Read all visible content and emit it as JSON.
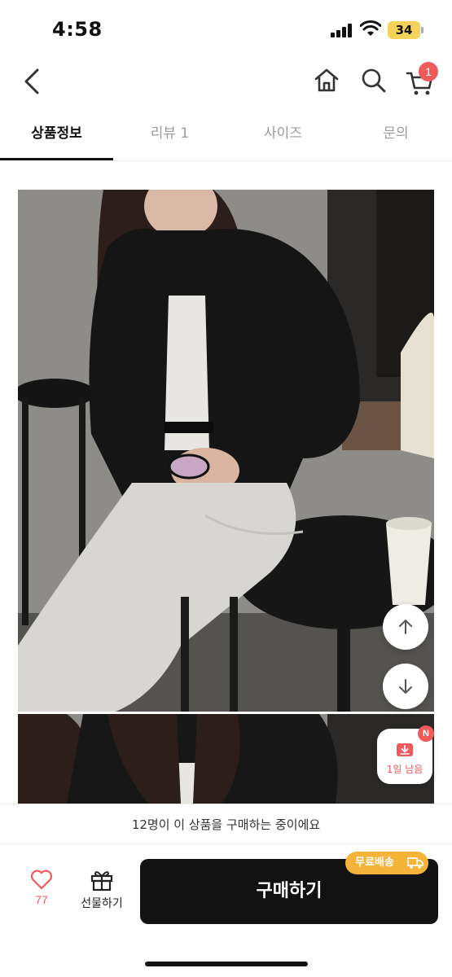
{
  "status_bar": {
    "time": "4:58",
    "battery": "34",
    "icons": [
      "signal-icon",
      "wifi-icon",
      "battery-icon"
    ]
  },
  "header": {
    "icons": [
      "back-icon",
      "home-icon",
      "search-icon",
      "cart-icon"
    ],
    "cart_badge": "1"
  },
  "tabs": [
    {
      "label": "상품정보",
      "active": true
    },
    {
      "label": "리뷰 1",
      "active": false
    },
    {
      "label": "사이즈",
      "active": false
    },
    {
      "label": "문의",
      "active": false
    }
  ],
  "floating": {
    "icons": [
      "arrow-up-icon",
      "arrow-down-icon",
      "ticket-icon"
    ],
    "new_badge": "N",
    "limited_label": "1일 남음"
  },
  "notice": "12명이 이 상품을 구매하는 중이에요",
  "bottom_bar": {
    "like_count": "77",
    "gift_label": "선물하기",
    "buy_label": "구매하기",
    "free_shipping": "무료배송",
    "icons": [
      "heart-icon",
      "gift-icon",
      "truck-icon"
    ]
  },
  "colors": {
    "accent_red": "#f05a5a",
    "buy_button": "#121212",
    "free_shipping_badge": "#f6b33a",
    "battery": "#f3d35a"
  }
}
